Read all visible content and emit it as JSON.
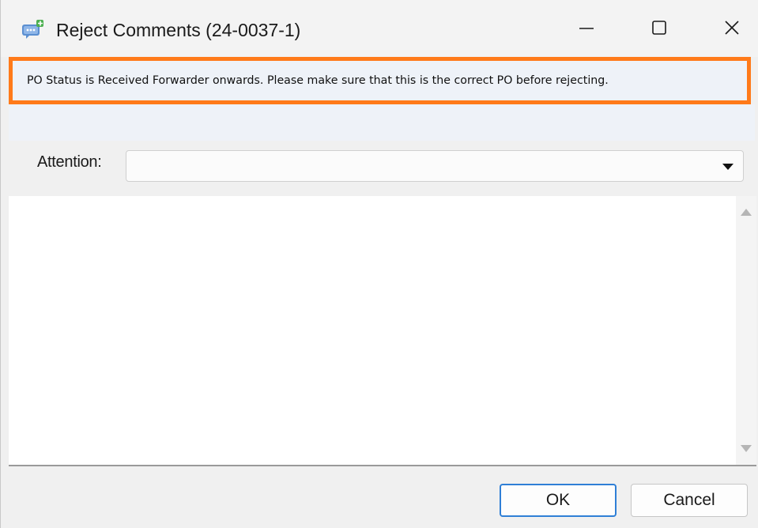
{
  "window": {
    "title": "Reject Comments (24-0037-1)",
    "app_icon": "comment-icon",
    "controls": {
      "minimize_icon": "minimize-icon",
      "maximize_icon": "maximize-icon",
      "close_icon": "close-icon"
    }
  },
  "banner": {
    "message": "PO Status is Received Forwarder onwards. Please make sure that this is the correct PO before rejecting.",
    "border_color": "#ff7a1a"
  },
  "form": {
    "attention_label": "Attention:",
    "attention_value": "",
    "comments_value": ""
  },
  "footer": {
    "ok_label": "OK",
    "cancel_label": "Cancel",
    "ok_border_color": "#2f7fd6"
  }
}
